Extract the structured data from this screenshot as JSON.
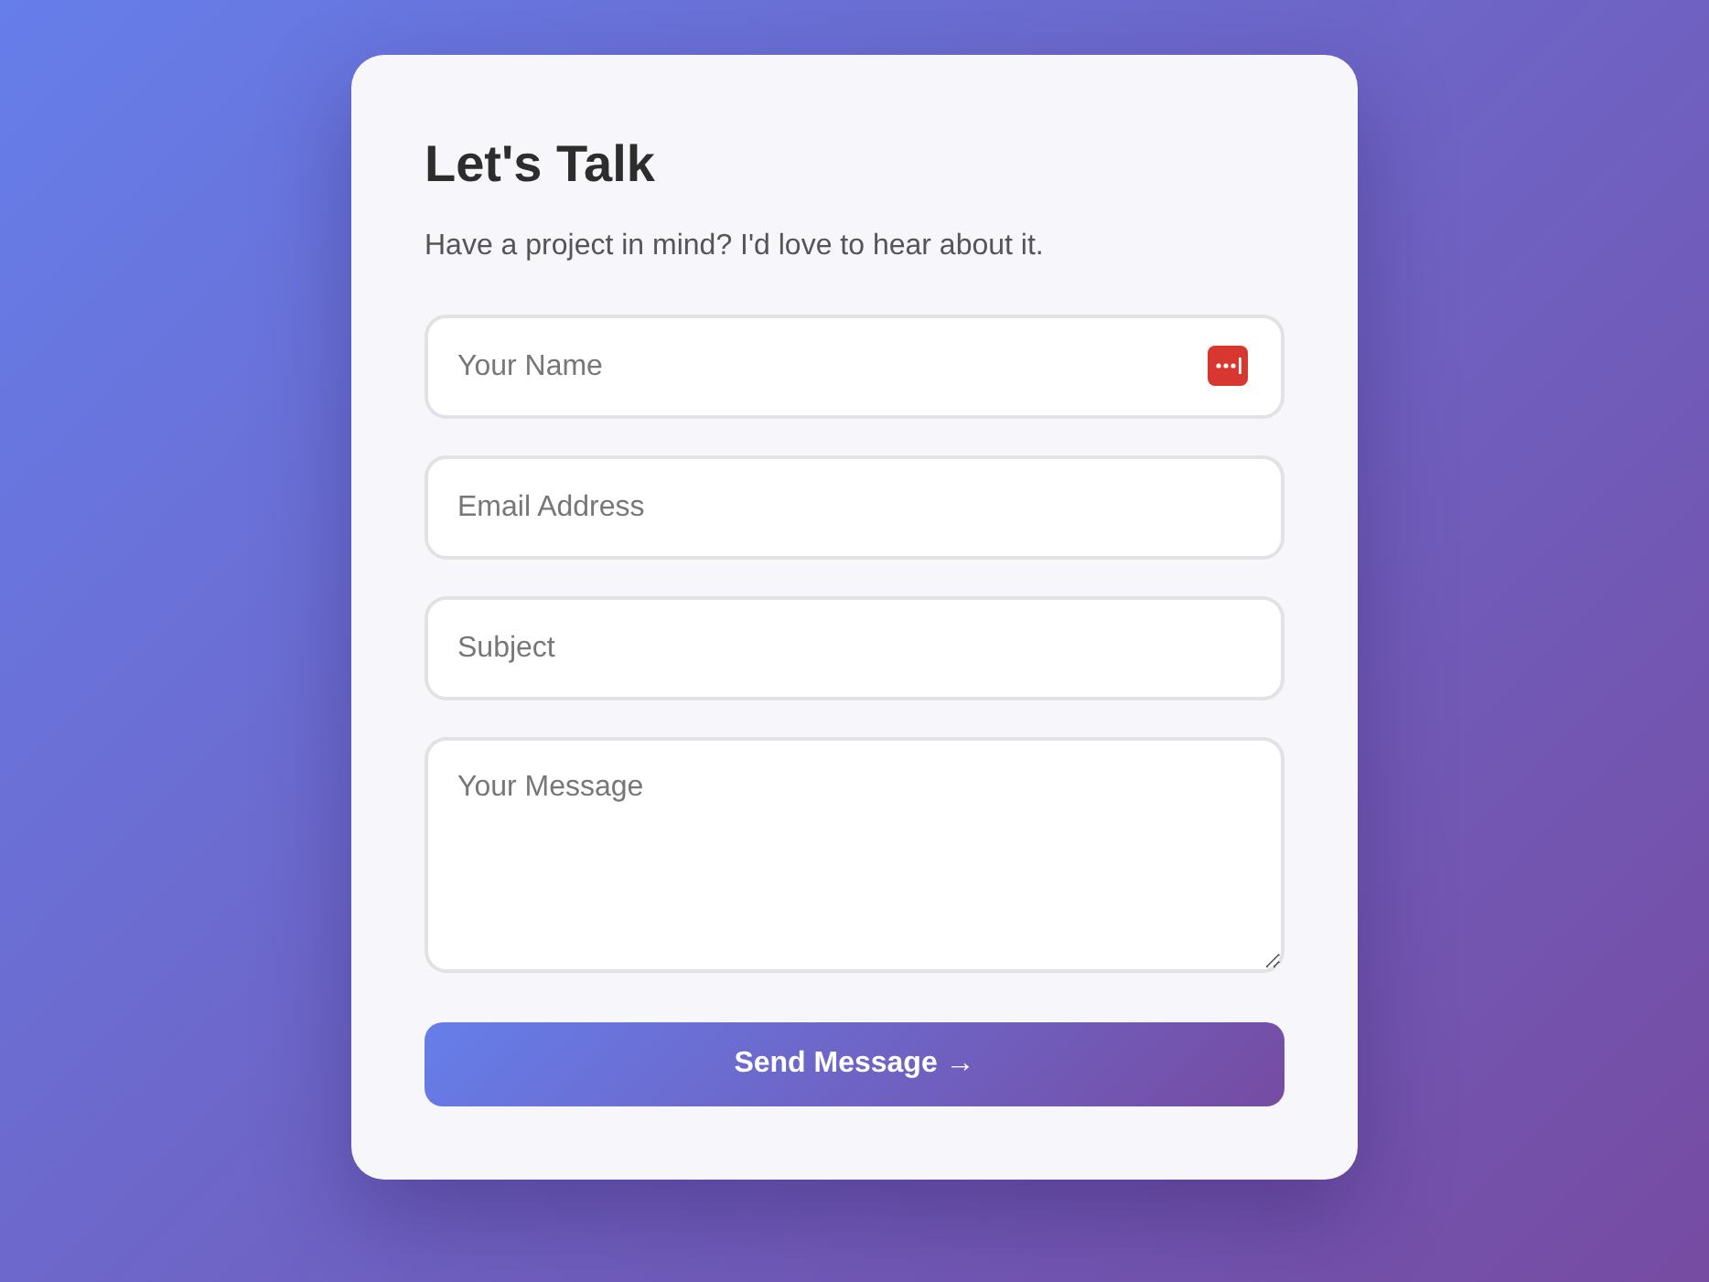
{
  "form": {
    "title": "Let's Talk",
    "subtitle": "Have a project in mind? I'd love to hear about it.",
    "fields": [
      {
        "kind": "input",
        "placeholder": "Your Name",
        "autofill_icon": true
      },
      {
        "kind": "input",
        "placeholder": "Email Address",
        "autofill_icon": false
      },
      {
        "kind": "input",
        "placeholder": "Subject",
        "autofill_icon": false
      },
      {
        "kind": "textarea",
        "placeholder": "Your Message"
      }
    ],
    "submit": "Send Message →"
  }
}
